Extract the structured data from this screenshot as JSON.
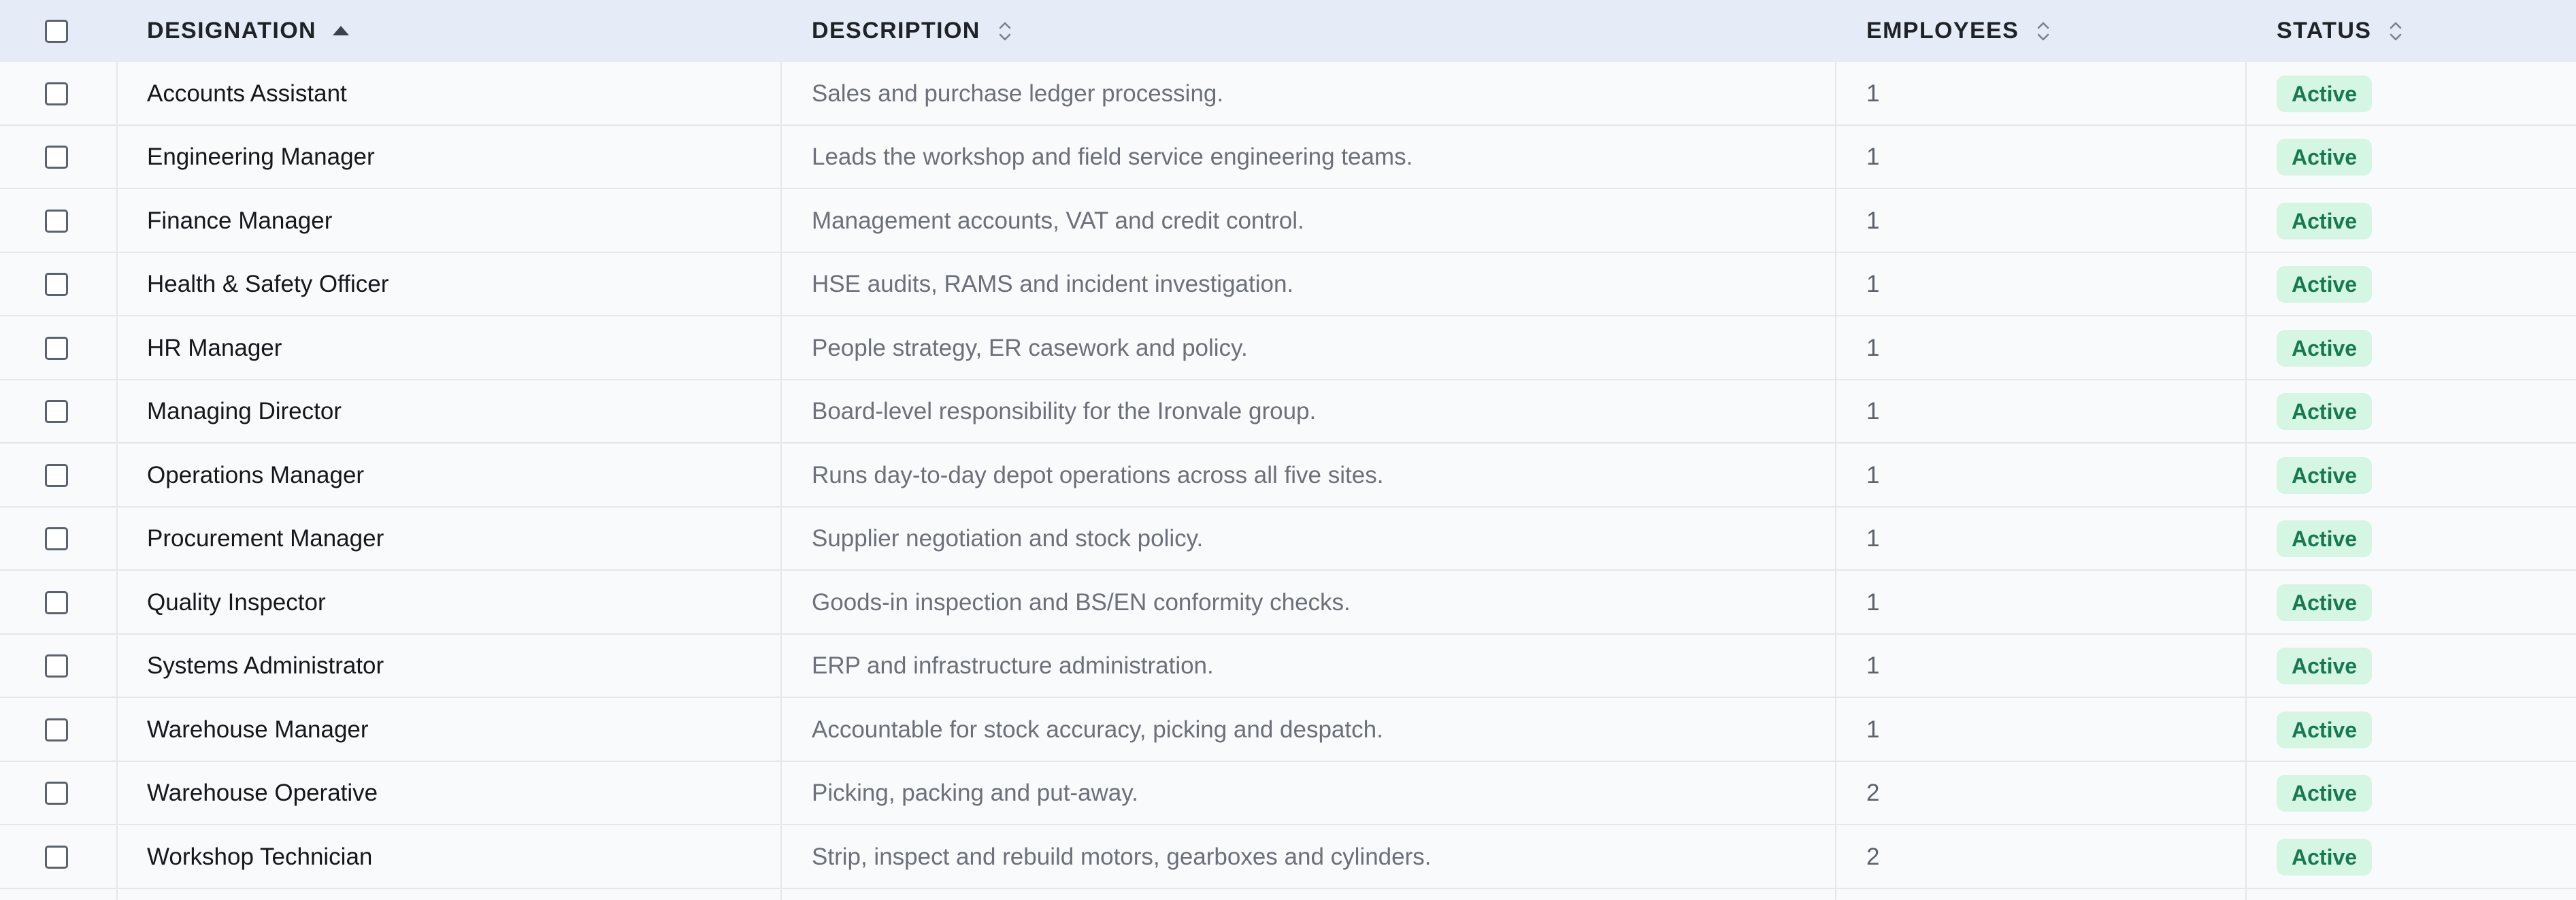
{
  "table": {
    "headers": {
      "designation": "DESIGNATION",
      "description": "DESCRIPTION",
      "employees": "EMPLOYEES",
      "status": "STATUS"
    },
    "sort": {
      "column": "designation",
      "direction": "ascending"
    },
    "colors": {
      "header_bg": "#e6ecf7",
      "row_bg": "#f9fafb",
      "badge_bg": "#d4f6e3",
      "badge_text": "#177a4e"
    },
    "rows": [
      {
        "designation": "Accounts Assistant",
        "description": "Sales and purchase ledger processing.",
        "employees": "1",
        "status": "Active"
      },
      {
        "designation": "Engineering Manager",
        "description": "Leads the workshop and field service engineering teams.",
        "employees": "1",
        "status": "Active"
      },
      {
        "designation": "Finance Manager",
        "description": "Management accounts, VAT and credit control.",
        "employees": "1",
        "status": "Active"
      },
      {
        "designation": "Health & Safety Officer",
        "description": "HSE audits, RAMS and incident investigation.",
        "employees": "1",
        "status": "Active"
      },
      {
        "designation": "HR Manager",
        "description": "People strategy, ER casework and policy.",
        "employees": "1",
        "status": "Active"
      },
      {
        "designation": "Managing Director",
        "description": "Board-level responsibility for the Ironvale group.",
        "employees": "1",
        "status": "Active"
      },
      {
        "designation": "Operations Manager",
        "description": "Runs day-to-day depot operations across all five sites.",
        "employees": "1",
        "status": "Active"
      },
      {
        "designation": "Procurement Manager",
        "description": "Supplier negotiation and stock policy.",
        "employees": "1",
        "status": "Active"
      },
      {
        "designation": "Quality Inspector",
        "description": "Goods-in inspection and BS/EN conformity checks.",
        "employees": "1",
        "status": "Active"
      },
      {
        "designation": "Systems Administrator",
        "description": "ERP and infrastructure administration.",
        "employees": "1",
        "status": "Active"
      },
      {
        "designation": "Warehouse Manager",
        "description": "Accountable for stock accuracy, picking and despatch.",
        "employees": "1",
        "status": "Active"
      },
      {
        "designation": "Warehouse Operative",
        "description": "Picking, packing and put-away.",
        "employees": "2",
        "status": "Active"
      },
      {
        "designation": "Workshop Technician",
        "description": "Strip, inspect and rebuild motors, gearboxes and cylinders.",
        "employees": "2",
        "status": "Active"
      }
    ]
  }
}
